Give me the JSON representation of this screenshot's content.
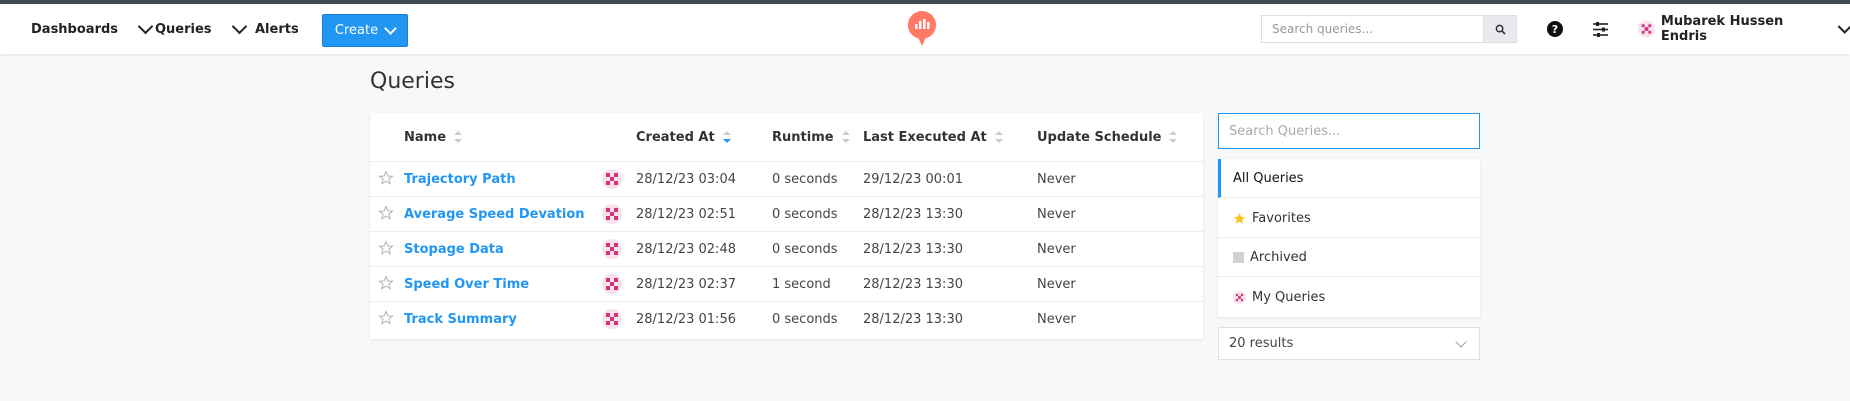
{
  "nav": {
    "dashboards": "Dashboards",
    "queries": "Queries",
    "alerts": "Alerts",
    "create": "Create",
    "search_placeholder": "Search queries...",
    "user_name": "Mubarek Hussen Endris",
    "brand_color": "#ff7964",
    "accent_color": "#2196f3"
  },
  "page": {
    "title": "Queries"
  },
  "table": {
    "columns": [
      "Name",
      "Created At",
      "Runtime",
      "Last Executed At",
      "Update Schedule"
    ],
    "rows": [
      {
        "name": "Trajectory Path",
        "created_at": "28/12/23 03:04",
        "runtime": "0 seconds",
        "last_executed": "29/12/23 00:01",
        "schedule": "Never"
      },
      {
        "name": "Average Speed Devation",
        "created_at": "28/12/23 02:51",
        "runtime": "0 seconds",
        "last_executed": "28/12/23 13:30",
        "schedule": "Never"
      },
      {
        "name": "Stopage Data",
        "created_at": "28/12/23 02:48",
        "runtime": "0 seconds",
        "last_executed": "28/12/23 13:30",
        "schedule": "Never"
      },
      {
        "name": "Speed Over Time",
        "created_at": "28/12/23 02:37",
        "runtime": "1 second",
        "last_executed": "28/12/23 13:30",
        "schedule": "Never"
      },
      {
        "name": "Track Summary",
        "created_at": "28/12/23 01:56",
        "runtime": "0 seconds",
        "last_executed": "28/12/23 13:30",
        "schedule": "Never"
      }
    ]
  },
  "sidebar": {
    "search_placeholder": "Search Queries...",
    "filters": [
      "All Queries",
      "Favorites",
      "Archived",
      "My Queries"
    ],
    "results": "20 results"
  }
}
